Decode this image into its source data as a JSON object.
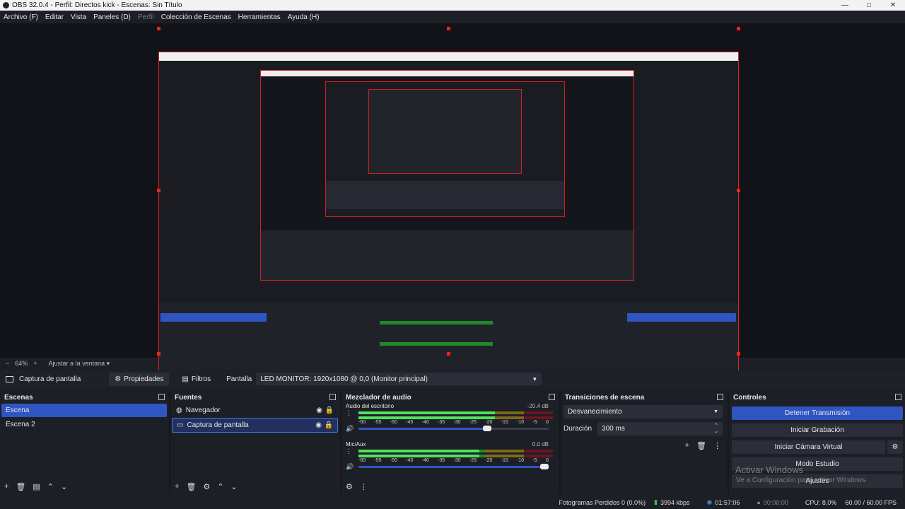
{
  "window": {
    "title": "OBS 32.0.4 - Perfil: Directos kick - Escenas: Sin Título",
    "min": "—",
    "max": "□",
    "close": "✕"
  },
  "menu": [
    {
      "label": "Archivo (F)"
    },
    {
      "label": "Editar"
    },
    {
      "label": "Vista"
    },
    {
      "label": "Paneles (D)"
    },
    {
      "label": "Perfil"
    },
    {
      "label": "Colección de Escenas"
    },
    {
      "label": "Herramientas"
    },
    {
      "label": "Ayuda (H)"
    }
  ],
  "zoom": {
    "minus": "−",
    "value": "64%",
    "plus": "+",
    "fit": "Ajustar a la ventana"
  },
  "source_bar": {
    "source_name": "Captura de pantalla",
    "properties": "Propiedades",
    "filters": "Filtros",
    "display_label": "Pantalla",
    "display_value": "LED MONITOR: 1920x1080 @ 0,0 (Monitor principal)"
  },
  "scenes": {
    "title": "Escenas",
    "items": [
      {
        "label": "Escena"
      },
      {
        "label": "Escena 2"
      }
    ]
  },
  "sources": {
    "title": "Fuentes",
    "items": [
      {
        "label": "Navegador"
      },
      {
        "label": "Captura de pantalla"
      }
    ]
  },
  "mixer": {
    "title": "Mezclador de audio",
    "channels": [
      {
        "name": "Audio del escritorio",
        "db": "-20.4 dB",
        "level": 0.7,
        "volume": 0.7
      },
      {
        "name": "Mic/Aux",
        "db": "0.0 dB",
        "level": 0.62,
        "volume": 1.0
      }
    ],
    "ticks": [
      "-60",
      "-55",
      "-50",
      "-45",
      "-40",
      "-35",
      "-30",
      "-25",
      "-20",
      "-15",
      "-10",
      "-5",
      "0"
    ]
  },
  "transitions": {
    "title": "Transiciones de escena",
    "selected": "Desvanecimiento",
    "duration_label": "Duración",
    "duration_value": "300 ms"
  },
  "controls": {
    "title": "Controles",
    "stop_stream": "Detener Transmisión",
    "start_record": "Iniciar Grabación",
    "virtual_cam": "Iniciar Cámara Virtual",
    "studio_mode": "Modo Estudio",
    "settings": "Ajustes"
  },
  "watermark": {
    "line1": "Activar Windows",
    "line2": "Ve a Configuración para activar Windows."
  },
  "status": {
    "dropped": "Fotogramas Perdidos 0 (0.0%)",
    "kbps": "3994 kbps",
    "stream_time": "01:57:06",
    "rec_time": "00:00:00",
    "cpu": "CPU: 8.0%",
    "fps": "60.00 / 60.00 FPS"
  },
  "colors": {
    "accent": "#2f55c2",
    "selection_border": "#dd2222",
    "bg": "#1d1f26"
  }
}
